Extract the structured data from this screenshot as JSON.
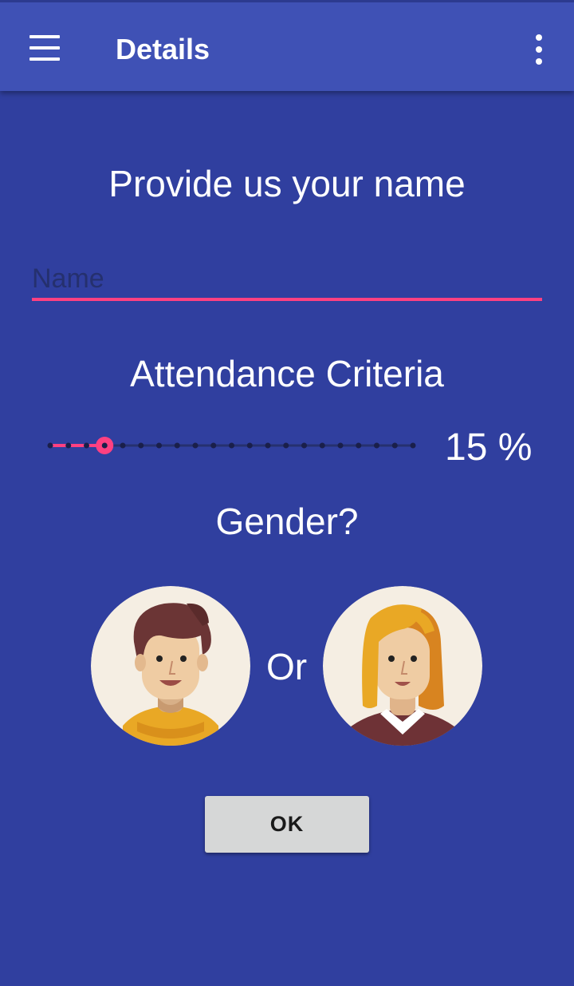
{
  "appbar": {
    "title": "Details",
    "menu_icon": "hamburger-menu-icon",
    "overflow_icon": "more-vert-icon",
    "color": "#3F51B5"
  },
  "background_color": "#303F9F",
  "accent_color": "#FF4081",
  "name_section": {
    "heading": "Provide us your name",
    "name_input": {
      "placeholder": "Name",
      "value": ""
    }
  },
  "attendance": {
    "heading": "Attendance Criteria",
    "slider": {
      "min": 0,
      "max": 100,
      "value": 15,
      "steps": 20
    },
    "value_label": "15 %"
  },
  "gender": {
    "heading": "Gender?",
    "separator": "Or",
    "male_icon": "male-avatar-icon",
    "female_icon": "female-avatar-icon"
  },
  "ok_button": {
    "label": "OK"
  }
}
